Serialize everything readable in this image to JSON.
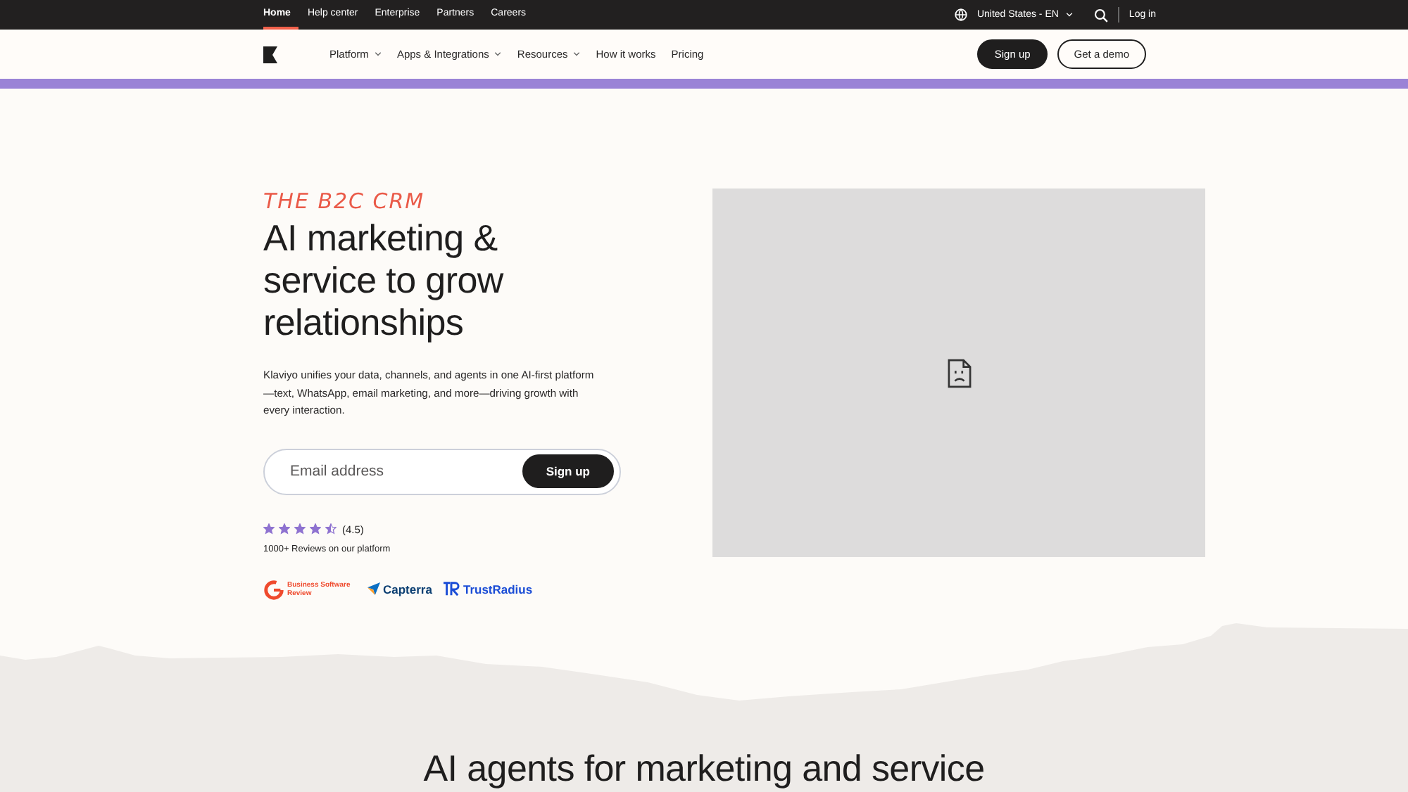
{
  "top_bar": {
    "links": [
      {
        "label": "Home",
        "selected": true
      },
      {
        "label": "Help center",
        "selected": false
      },
      {
        "label": "Enterprise",
        "selected": false
      },
      {
        "label": "Partners",
        "selected": false
      },
      {
        "label": "Careers",
        "selected": false
      }
    ],
    "locale": "United States - EN",
    "login": "Log in"
  },
  "nav": {
    "items": [
      {
        "label": "Platform",
        "dropdown": true
      },
      {
        "label": "Apps & Integrations",
        "dropdown": true
      },
      {
        "label": "Resources",
        "dropdown": true
      },
      {
        "label": "How it works",
        "dropdown": false
      },
      {
        "label": "Pricing",
        "dropdown": false
      }
    ],
    "sign_up": "Sign up",
    "demo": "Get a demo"
  },
  "hero": {
    "eyebrow": "THE B2C CRM",
    "title": "AI marketing & service to grow relationships",
    "body": "Klaviyo unifies your data, channels, and agents in one AI-first platform—text, WhatsApp, email marketing, and more—driving growth with every interaction.",
    "email": {
      "placeholder": "Email address",
      "button": "Sign up"
    },
    "stars": 4.5,
    "rating": "(4.5)",
    "reviews": "1000+ Reviews on our platform",
    "badges": [
      {
        "kind": "g2",
        "label": "Business Software Review"
      },
      {
        "kind": "capterra",
        "label": "Capterra"
      },
      {
        "kind": "trustradius",
        "label": "TrustRadius"
      }
    ]
  },
  "next_section": {
    "title": "AI agents for marketing and service"
  }
}
